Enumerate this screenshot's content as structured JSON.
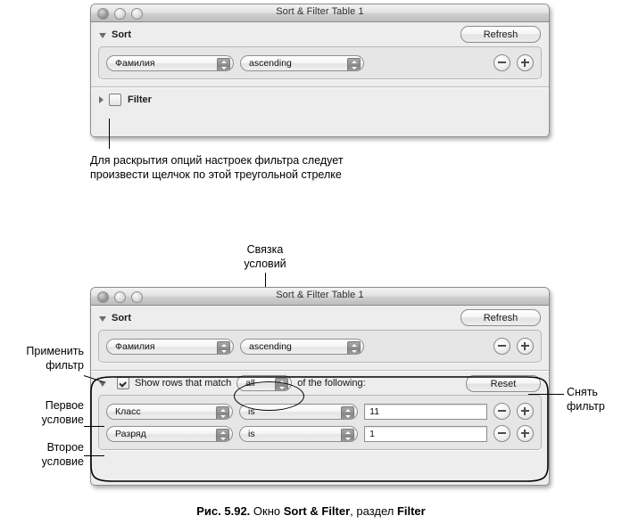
{
  "window1": {
    "title": "Sort & Filter Table 1",
    "sort": {
      "label": "Sort",
      "refresh_label": "Refresh",
      "rows": [
        {
          "field": "Фамилия",
          "order": "ascending",
          "minus": "−",
          "plus": "+"
        }
      ]
    },
    "filter": {
      "label": "Filter",
      "checked": false
    }
  },
  "window2": {
    "title": "Sort & Filter Table 1",
    "sort": {
      "label": "Sort",
      "refresh_label": "Refresh",
      "rows": [
        {
          "field": "Фамилия",
          "order": "ascending",
          "minus": "−",
          "plus": "+"
        }
      ]
    },
    "filter": {
      "prefix": "Show rows that match",
      "match": "all",
      "suffix": "of the following:",
      "reset_label": "Reset",
      "checked": true,
      "conditions": [
        {
          "field": "Класс",
          "operator": "is",
          "value": "11"
        },
        {
          "field": "Разряд",
          "operator": "is",
          "value": "1"
        }
      ]
    }
  },
  "annotations": {
    "disclosure_note": "Для раскрытия опций  настроек фильтра следует\nпроизвести щелчок по этой треугольной стрелке",
    "match_note": "Связка\nусловий",
    "apply_filter": "Применить\nфильтр",
    "first_condition": "Первое\nусловие",
    "second_condition": "Второе\nусловие",
    "clear_filter": "Снять\nфильтр"
  },
  "caption": {
    "fig": "Рис. 5.92.",
    "text1": " Окно ",
    "bold1": "Sort & Filter",
    "text2": ", раздел ",
    "bold2": "Filter"
  }
}
